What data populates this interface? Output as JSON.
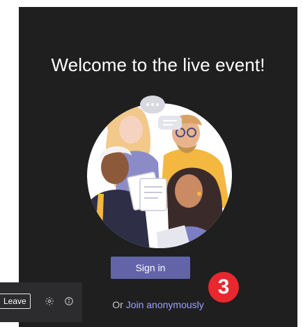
{
  "welcome": {
    "title": "Welcome to the live event!"
  },
  "actions": {
    "sign_in_label": "Sign in",
    "or_text": "Or",
    "join_anonymously_label": "Join anonymously"
  },
  "toolbar": {
    "leave_label": "Leave",
    "icons": [
      "settings-icon",
      "info-icon"
    ]
  },
  "callout": {
    "step_number": "3"
  },
  "colors": {
    "panel_bg": "#1f1f1f",
    "primary_button": "#6264a7",
    "link": "#9ea2ff",
    "badge": "#e8272e",
    "toolbar_bg": "#2c2c2e"
  }
}
